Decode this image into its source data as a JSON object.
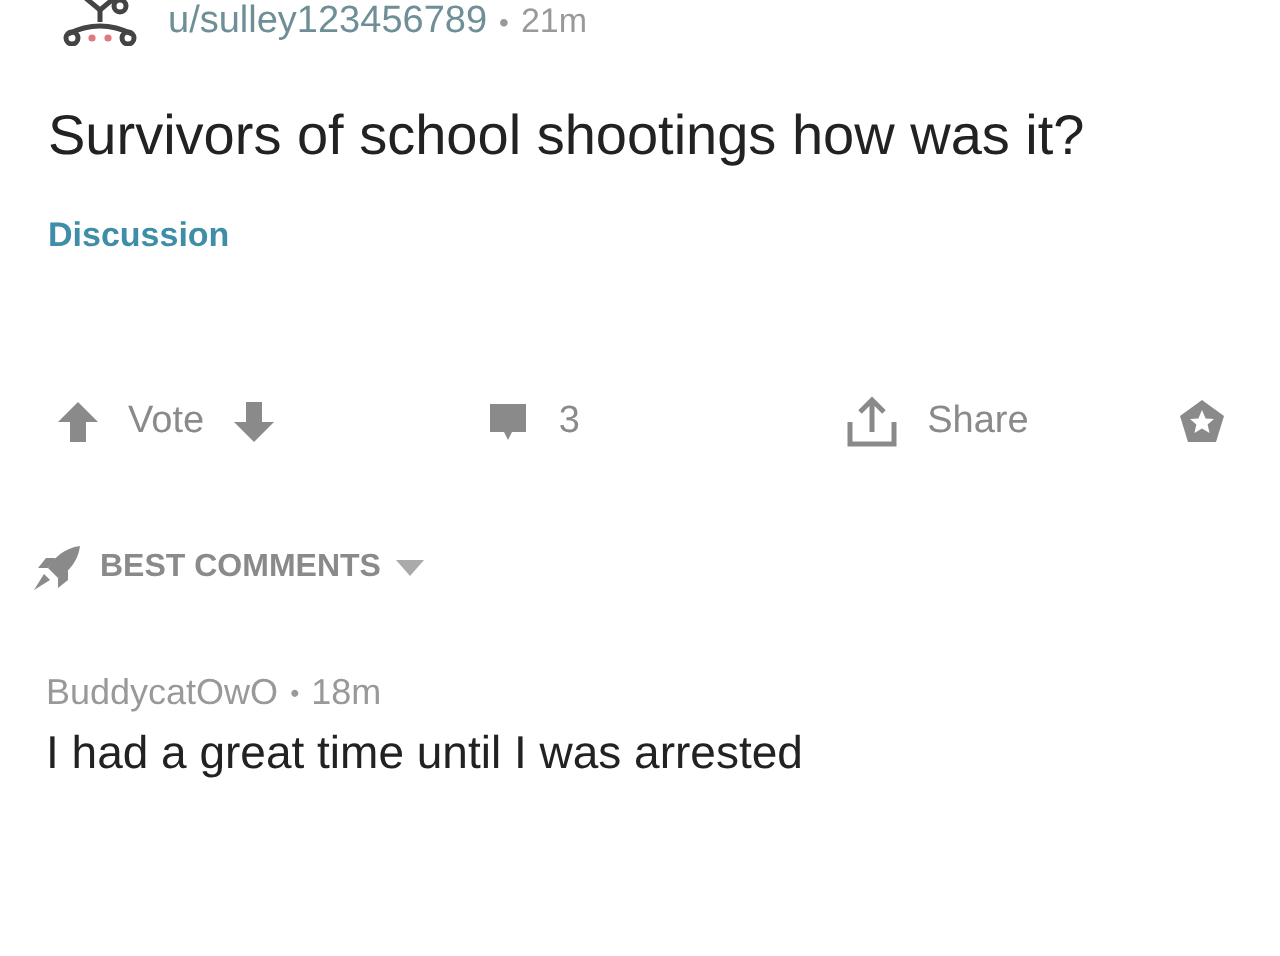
{
  "post": {
    "author": "u/sulley123456789",
    "separator": "•",
    "age": "21m",
    "title": "Survivors of school shootings how was it?",
    "flair": "Discussion"
  },
  "actions": {
    "vote_label": "Vote",
    "comment_count": "3",
    "share_label": "Share"
  },
  "sort": {
    "label": "BEST COMMENTS"
  },
  "comments": [
    {
      "author": "BuddycatOwO",
      "separator": "•",
      "age": "18m",
      "body": "I had a great time until I was arrested"
    }
  ]
}
